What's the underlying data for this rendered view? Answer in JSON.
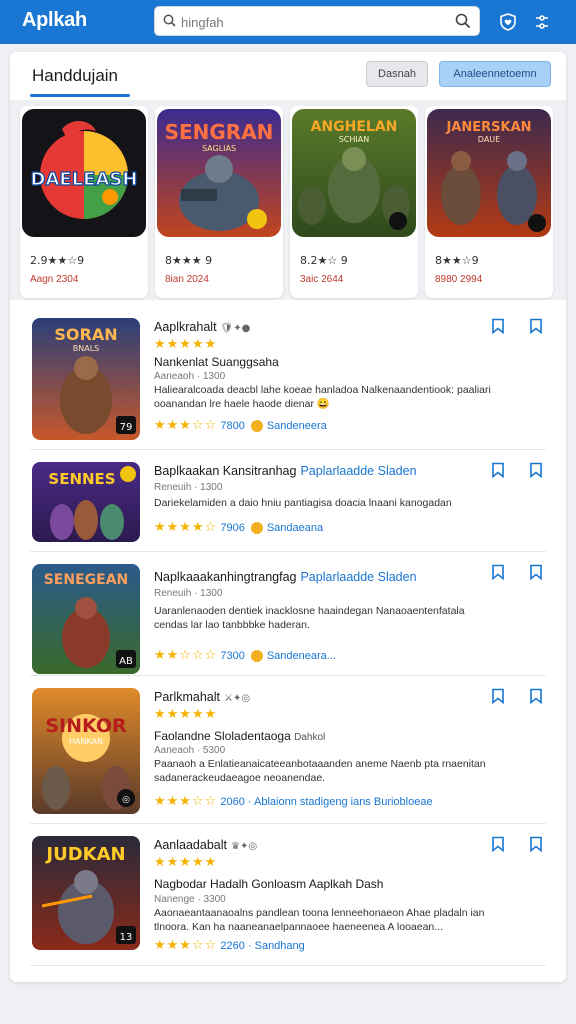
{
  "app": {
    "brand": "Aplkah",
    "search_placeholder": "hingfah",
    "icons": [
      "search-icon",
      "heart-shield-icon",
      "shuffle-icon"
    ]
  },
  "header": {
    "title": "Handdujain",
    "button_secondary": "Dasnah",
    "button_primary": "Analeennetoemn"
  },
  "featured": [
    {
      "art": "DAELEASH",
      "rating": "2.9★★☆9",
      "date": "Aagn 2304"
    },
    {
      "art": "SENGRAN",
      "art_sub": "SAGLIAS",
      "rating": "8★★★ 9",
      "date": "8ian 2024"
    },
    {
      "art": "ANGHELAN",
      "art_sub": "SCHIAN",
      "rating": "8.2★☆ 9",
      "date": "3aic 2644"
    },
    {
      "art": "JANERSKAN",
      "art_sub": "DAUE",
      "rating": "8★★☆9",
      "date": "8980 2994"
    }
  ],
  "list": [
    {
      "art": "SORAN",
      "art_sub": "BNALS",
      "title": "Aaplkrahalt",
      "emoji": "🛡✦●",
      "stars": "★★★★★",
      "subtitle": "Nankenlat Suanggsaha",
      "meta": "Aaneaoh · 1300",
      "desc": "Haliearalcoada deacbl lahe koeae hanladoa Nalkenaandentiook: paaliari ooanandan lre haele haode dienar 😀",
      "foot_stars": "★★★☆☆",
      "foot_score": "7800",
      "foot_link": "Sandeneera",
      "badge": "79"
    },
    {
      "art": "SENNES",
      "title": "Baplkaakan Kansitranhag",
      "title_extra": "Paplarlaadde Sladen",
      "stars": "",
      "subtitle": "",
      "meta": "Reneuih · 1300",
      "desc": "Dariekelamiden a daio hniu pantiagisa doacia lnaani kanogadan",
      "foot_stars": "★★★★☆",
      "foot_score": "7906",
      "foot_link": "Sandaeana",
      "badge": ""
    },
    {
      "art": "SENEGEAN",
      "title": "Naplkaaakanhingtrangfag",
      "title_extra": "Paplarlaadde Sladen",
      "stars": "",
      "subtitle": "",
      "meta": "Reneuih · 1300",
      "desc": "Uaranlenaoden dentiek inacklosne haaindegan Nanaoaentenfatala cendas lar lao tanbbbke haderan.",
      "foot_stars": "★★☆☆☆",
      "foot_score": "7300",
      "foot_link": "Sandeneara...",
      "badge": "AB"
    },
    {
      "art": "SINKOR",
      "art_sub": "HANKAN",
      "title": "Parlkmahalt",
      "emoji": "⚔✦◎",
      "stars": "★★★★★",
      "subtitle": "Faolandne Sloladentaoga",
      "subtitle_extra": "Dahkol",
      "meta": "Aaneaoh · 5300",
      "desc": "Paanaoh a Enlatieanaicateeanbotaaanden aneme Naenb pta rnaenitan sadanerackeudaeagoe neoanendae.",
      "foot_stars": "★★★☆☆",
      "foot_score": "2060",
      "foot_link": "Ablaionn stadigeng ians Buriobloeae",
      "badge": "◎"
    },
    {
      "art": "JUDKAN",
      "title": "Aanlaadabalt",
      "emoji": "♛✦◎",
      "stars": "★★★★★",
      "subtitle": "Nagbodar Hadalh Gonloasm Aaplkah Dash",
      "meta": "Nanenge · 3300",
      "desc": "Aaonaeantaanaoalns pandlean toona lenneehonaeon Ahae pladaln ian tlnoora. Kan ha naaneanaelpannaoee haeneenea A looaean...",
      "foot_stars": "★★★☆☆",
      "foot_score": "2260",
      "foot_link": "Sandhang",
      "badge": "13"
    }
  ],
  "colors": {
    "accent": "#1976d2",
    "star": "#f5b301",
    "date_red": "#c0392b"
  }
}
